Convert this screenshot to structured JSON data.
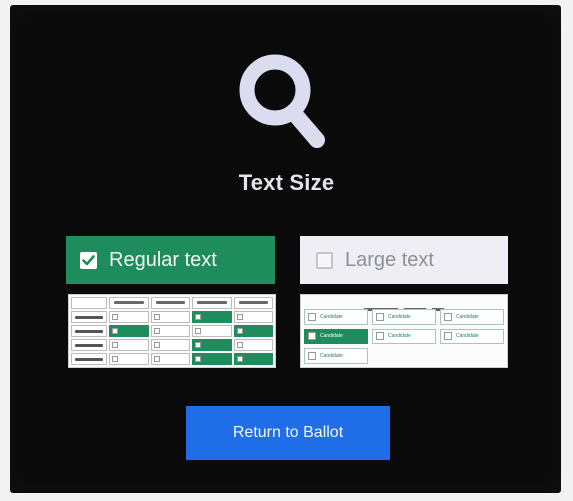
{
  "header": {
    "icon": "magnifier-icon",
    "title": "Text Size"
  },
  "options": {
    "regular": {
      "label": "Regular text",
      "checked": true
    },
    "large": {
      "label": "Large text",
      "checked": false
    }
  },
  "preview_large": {
    "cell_label": "Candidate"
  },
  "footer": {
    "return_label": "Return to Ballot"
  },
  "colors": {
    "selected": "#1e8c5c",
    "button": "#1f6ee8",
    "background": "#0a0a0a"
  }
}
